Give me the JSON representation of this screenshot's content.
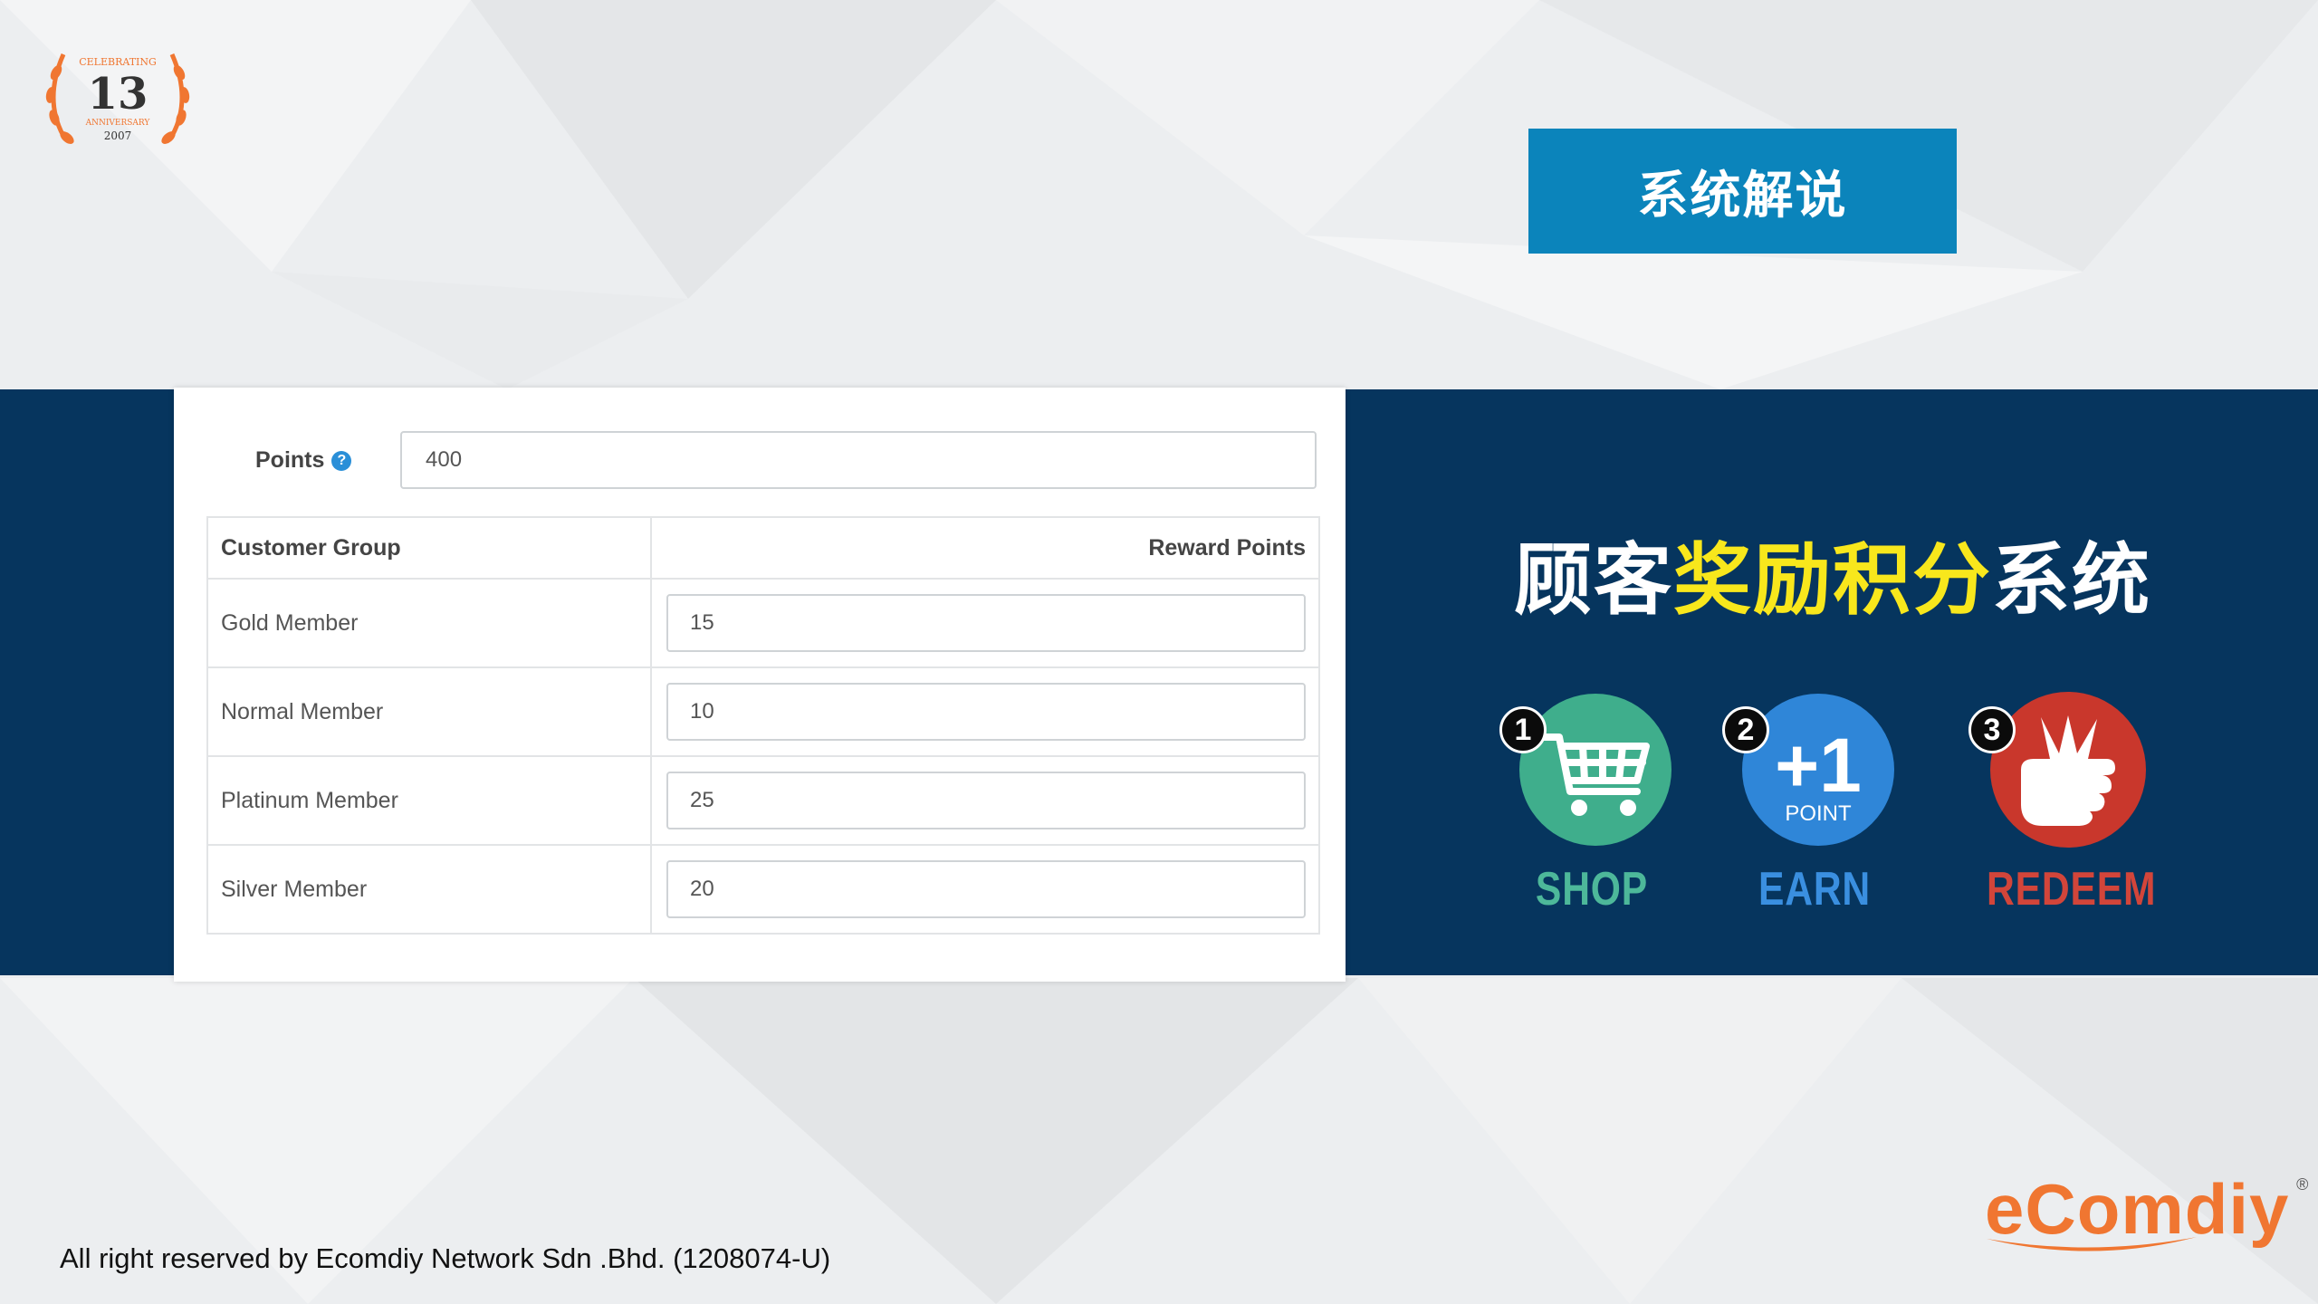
{
  "badge": {
    "top_text": "CELEBRATING",
    "number": "13",
    "middle_text": "ANNIVERSARY",
    "year": "2007",
    "color": "#f07631"
  },
  "title_box": {
    "label": "系统解说",
    "color": "#0b84bb"
  },
  "form": {
    "points_label": "Points",
    "points_help_icon": "question-circle-icon",
    "points_value": "400",
    "table": {
      "headers": [
        "Customer Group",
        "Reward Points"
      ],
      "rows": [
        {
          "group": "Gold Member",
          "value": "15"
        },
        {
          "group": "Normal Member",
          "value": "10"
        },
        {
          "group": "Platinum Member",
          "value": "25"
        },
        {
          "group": "Silver Member",
          "value": "20"
        }
      ]
    }
  },
  "headline": {
    "part1": "顾客",
    "highlight": "奖励积分",
    "part2": "系统",
    "highlight_color": "#f8e71c"
  },
  "steps": [
    {
      "number": "1",
      "label": "SHOP",
      "icon": "shopping-cart-icon",
      "circle_color": "#3fae8c",
      "label_color": "#4db89a"
    },
    {
      "number": "2",
      "label": "EARN",
      "icon": "plus-one-point-icon",
      "icon_text_big": "+1",
      "icon_text_small": "POINT",
      "circle_color": "#2f86d8",
      "label_color": "#3a8fe0"
    },
    {
      "number": "3",
      "label": "REDEEM",
      "icon": "hand-money-icon",
      "circle_color": "#c9372c",
      "label_color": "#d2453a"
    }
  ],
  "footer": {
    "text": "All right reserved by Ecomdiy Network Sdn .Bhd. (1208074-U)"
  },
  "logo": {
    "text": "eComdiy",
    "reg": "®",
    "color": "#f07631"
  }
}
